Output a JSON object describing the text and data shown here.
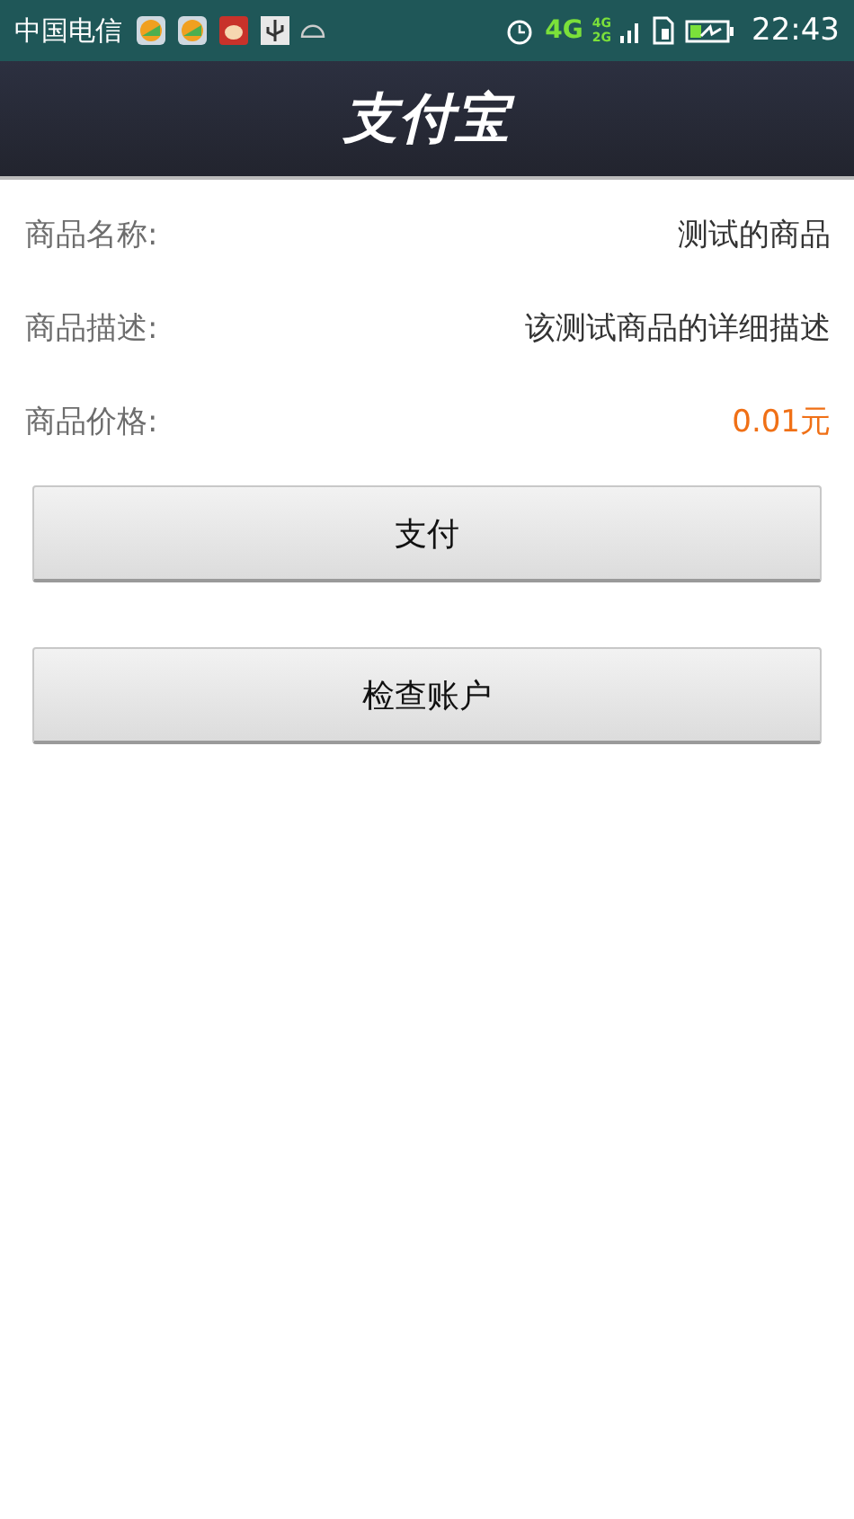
{
  "status_bar": {
    "carrier": "中国电信",
    "network": "4G",
    "network_small": [
      "4G",
      "2G"
    ],
    "time": "22:43"
  },
  "header": {
    "logo": "支付宝"
  },
  "fields": [
    {
      "label": "商品名称:",
      "value": "测试的商品",
      "kind": "text"
    },
    {
      "label": "商品描述:",
      "value": "该测试商品的详细描述",
      "kind": "text"
    },
    {
      "label": "商品价格:",
      "value": "0.01元",
      "kind": "price"
    }
  ],
  "buttons": [
    "支付",
    "检查账户"
  ]
}
